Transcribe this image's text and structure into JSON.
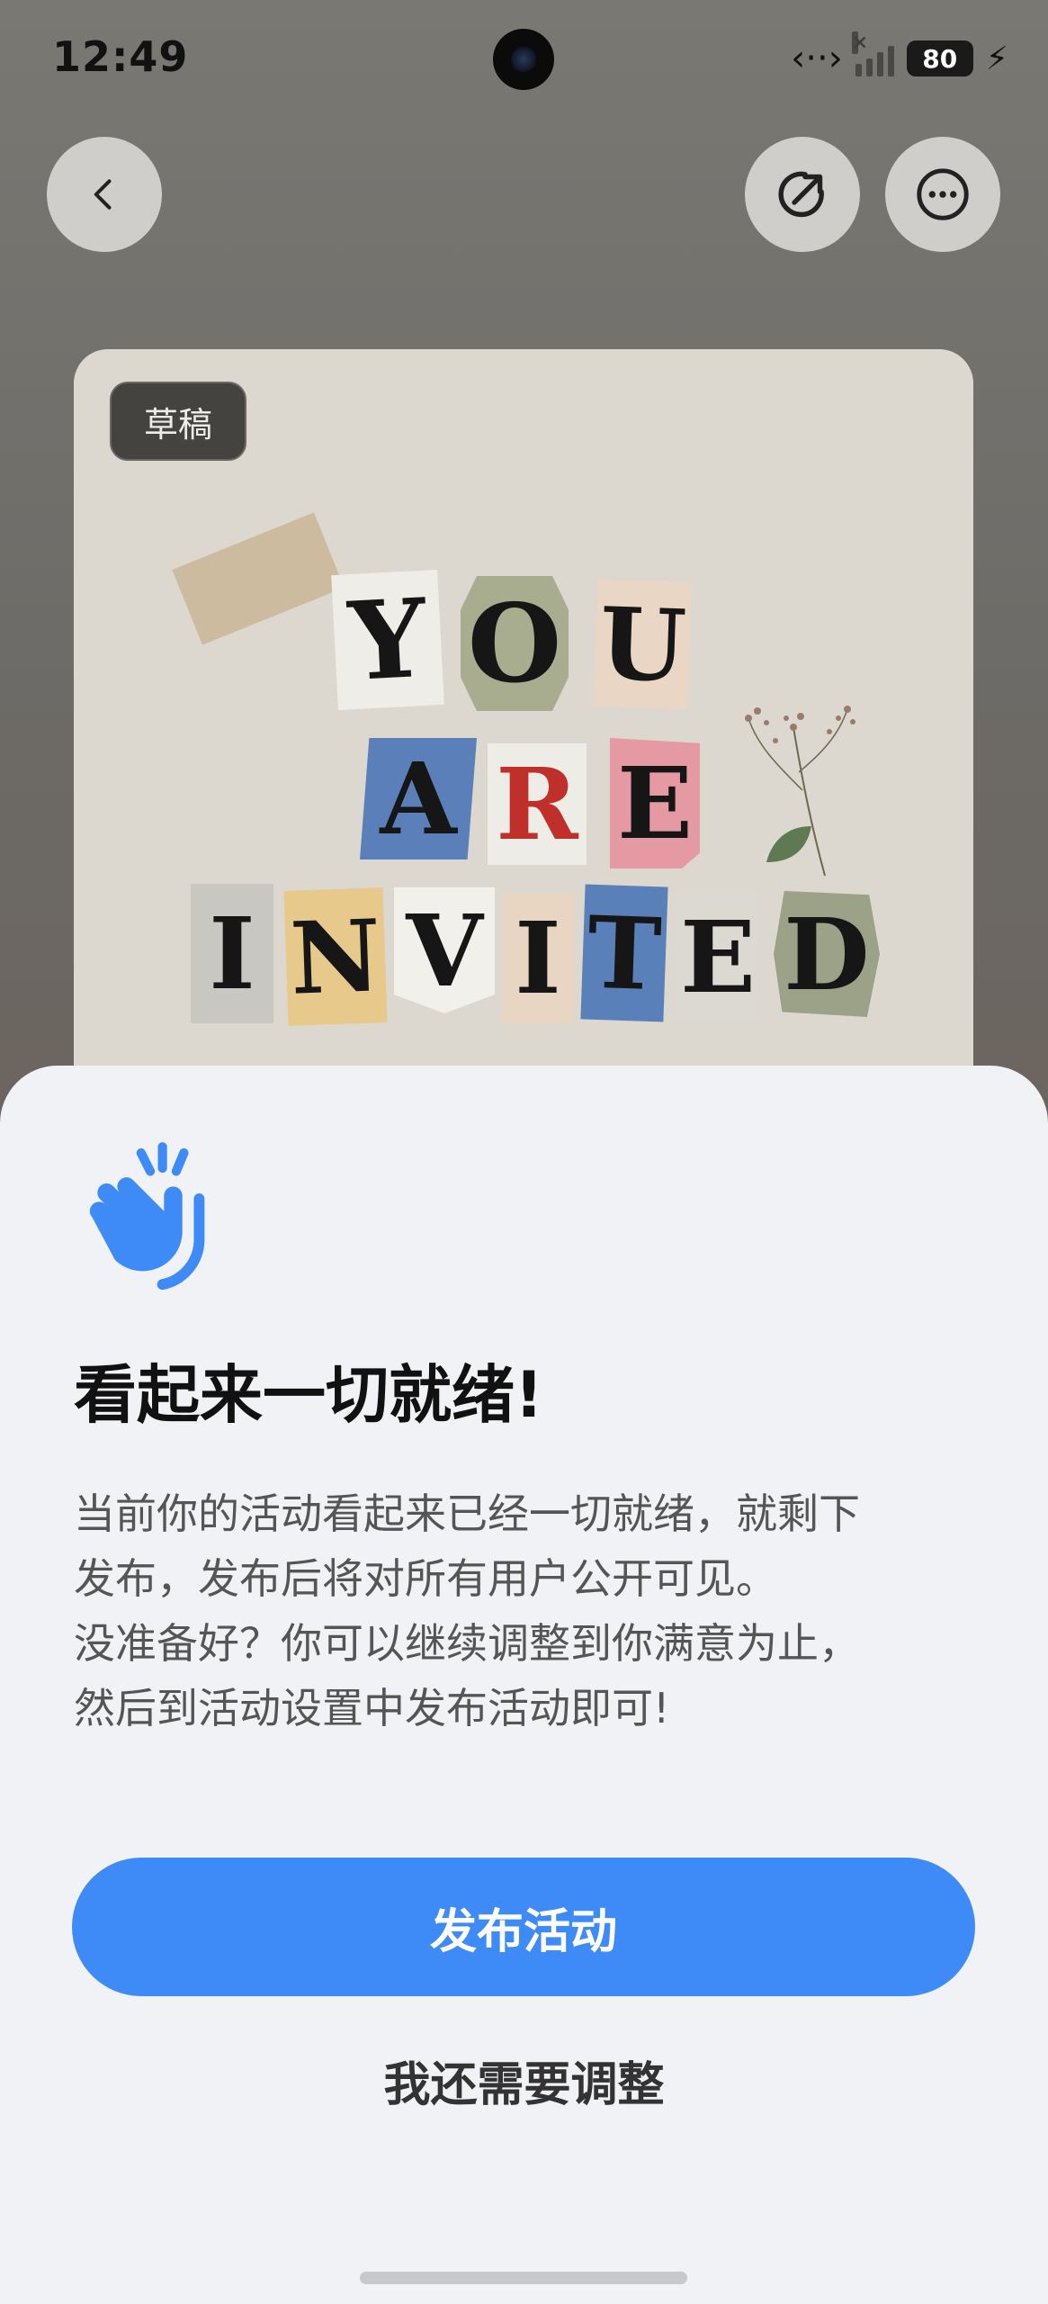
{
  "status_bar": {
    "time": "12:49",
    "battery": "80"
  },
  "nav": {
    "back_icon": "chevron-left-icon",
    "share_icon": "share-arrow-icon",
    "more_icon": "more-dots-icon"
  },
  "poster": {
    "badge": "草稿",
    "line1": [
      "Y",
      "O",
      "U"
    ],
    "line2": [
      "A",
      "R",
      "E"
    ],
    "line3": [
      "I",
      "N",
      "V",
      "I",
      "T",
      "E",
      "D"
    ]
  },
  "sheet": {
    "icon": "waving-hand-icon",
    "title": "看起来一切就绪!",
    "body_lines": [
      "当前你的活动看起来已经一切就绪，就剩下",
      "发布，发布后将对所有用户公开可见。",
      "没准备好？你可以继续调整到你满意为止，",
      "然后到活动设置中发布活动即可!"
    ],
    "primary_button": "发布活动",
    "secondary_button": "我还需要调整"
  },
  "colors": {
    "accent": "#3e8bf8",
    "sheet_bg": "#f0f2f5"
  }
}
